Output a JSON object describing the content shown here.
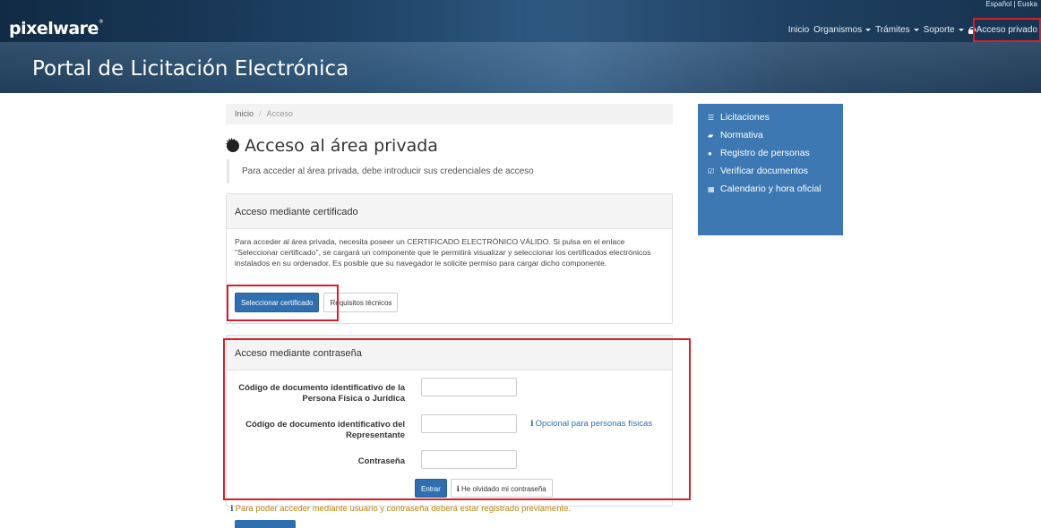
{
  "header": {
    "logo": "pixelware",
    "logo_mark": "®",
    "languages": "Español | Euska",
    "portal_title": "Portal de Licitación Electrónica",
    "nav": {
      "inicio": "Inicio",
      "organismos": "Organismos",
      "tramites": "Trámites",
      "soporte": "Soporte",
      "acceso_privado": "Acceso privado"
    }
  },
  "breadcrumb": {
    "home": "Inicio",
    "separator": "/",
    "current": "Acceso"
  },
  "page": {
    "title": "Acceso al área privada",
    "lead": "Para acceder al área privada, debe introducir sus credenciales de acceso"
  },
  "cert_panel": {
    "heading": "Acceso mediante certificado",
    "body": "Para acceder al área privada, necesita poseer un CERTIFICADO ELECTRÓNICO VÁLIDO. Si pulsa en el enlace \"Seleccionar certificado\", se cargará un componente que le permitirá visualizar y seleccionar los certificados electrónicos instalados en su ordenador. Es posible que su navegador le solicite permiso para cargar dicho componente.",
    "select_button": "Seleccionar certificado",
    "requirements_button": "Requisitos técnicos"
  },
  "pass_panel": {
    "heading": "Acceso mediante contraseña",
    "field1_label": "Código de documento identificativo de la Persona Física o Jurídica",
    "field1_value": "",
    "field2_label": "Código de documento identificativo del Representante",
    "field2_value": "",
    "field2_hint": "Opcional para personas físicas",
    "field3_label": "Contraseña",
    "field3_value": "",
    "submit_button": "Entrar",
    "forgot_button": "He olvidado mi contraseña",
    "note": "Para poder acceder mediante usuario y contraseña deberá estar registrado previamente."
  },
  "sidemenu": {
    "items": [
      {
        "label": "Licitaciones",
        "icon": "list-icon"
      },
      {
        "label": "Normativa",
        "icon": "book-icon"
      },
      {
        "label": "Registro de personas",
        "icon": "user-icon"
      },
      {
        "label": "Verificar documentos",
        "icon": "checkbox-icon"
      },
      {
        "label": "Calendario y hora oficial",
        "icon": "calendar-icon"
      }
    ]
  },
  "colors": {
    "accent": "#2f6fb0",
    "sidemenu": "#3e78b3",
    "highlight": "#d61f2c"
  }
}
